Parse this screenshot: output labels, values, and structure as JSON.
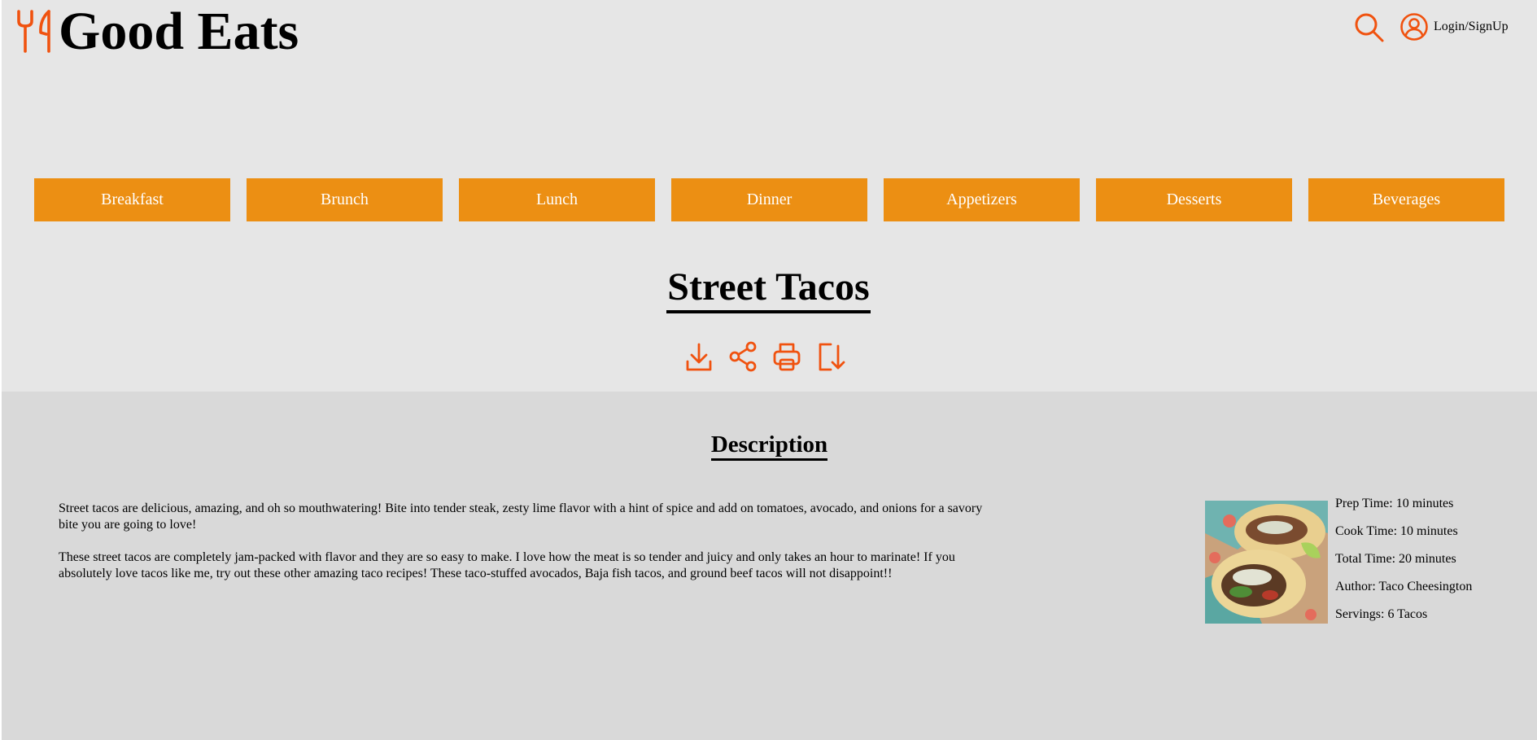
{
  "brand": {
    "name": "Good Eats",
    "accent_color": "#f0520f",
    "nav_color": "#ec8f13"
  },
  "header": {
    "logo_icon": "fork-knife-icon",
    "search_icon": "search-icon",
    "account_icon": "user-circle-icon",
    "login_label": "Login/SignUp"
  },
  "nav": {
    "items": [
      {
        "label": "Breakfast"
      },
      {
        "label": "Brunch"
      },
      {
        "label": "Lunch"
      },
      {
        "label": "Dinner"
      },
      {
        "label": "Appetizers"
      },
      {
        "label": "Desserts"
      },
      {
        "label": "Beverages"
      }
    ]
  },
  "recipe": {
    "title": "Street Tacos",
    "actions": [
      {
        "name": "download",
        "icon": "download-icon"
      },
      {
        "name": "share",
        "icon": "share-icon"
      },
      {
        "name": "print",
        "icon": "print-icon"
      },
      {
        "name": "save",
        "icon": "bookmark-arrow-icon"
      }
    ],
    "description_heading": "Description",
    "paragraphs": [
      "Street tacos are delicious, amazing, and oh so mouthwatering! Bite into tender steak, zesty lime flavor with a hint of spice and add on tomatoes, avocado, and onions for a savory bite you are going to love!",
      "These street tacos are completely jam-packed with flavor and they are so easy to make. I love how the meat is so tender and juicy and only takes an hour to marinate! If you absolutely love tacos like me, try out these other amazing taco recipes! These taco-stuffed avocados, Baja fish tacos, and ground beef tacos will not disappoint!!"
    ],
    "info": {
      "prep_time": "Prep Time: 10 minutes",
      "cook_time": "Cook Time: 10 minutes",
      "total_time": "Total Time: 20 minutes",
      "author": "Author: Taco Cheesington",
      "servings": "Servings: 6 Tacos"
    }
  }
}
